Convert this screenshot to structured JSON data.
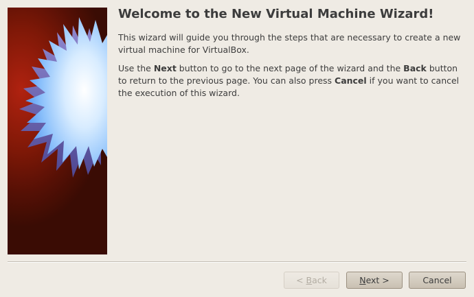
{
  "wizard": {
    "title": "Welcome to the New Virtual Machine Wizard!",
    "paragraph1": "This wizard will guide you through the steps that are necessary to create a new virtual machine for VirtualBox.",
    "paragraph2": {
      "t1": "Use the ",
      "b1": "Next",
      "t2": " button to go to the next page of the wizard and the ",
      "b2": "Back",
      "t3": " button to return to the previous page. You can also press ",
      "b3": "Cancel",
      "t4": " if you want to cancel the execution of this wizard."
    }
  },
  "buttons": {
    "back": {
      "prefix": "< ",
      "mnemonic": "B",
      "rest": "ack",
      "enabled": false
    },
    "next": {
      "mnemonic": "N",
      "rest": "ext >",
      "enabled": true
    },
    "cancel": {
      "label": "Cancel",
      "enabled": true
    }
  },
  "banner": {
    "image": "virtualbox-starburst-logo",
    "colors": {
      "background": "#7e1807",
      "burst_top": "#6fa8f5",
      "burst_side": "#6b64b0"
    }
  }
}
